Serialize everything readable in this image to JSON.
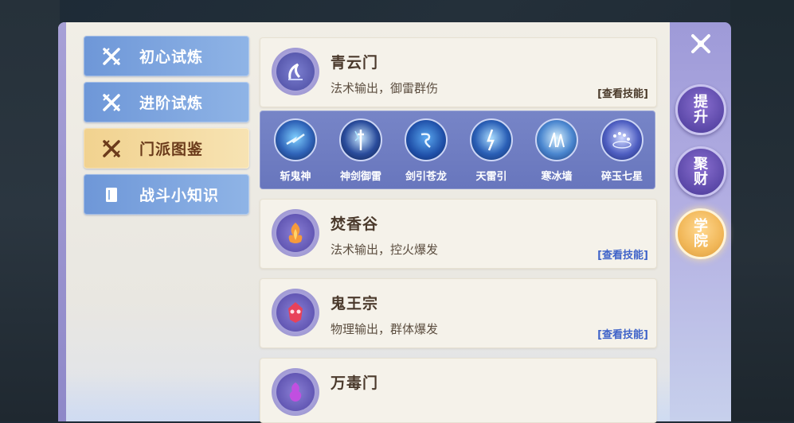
{
  "sidebar": {
    "items": [
      {
        "label": "初心试炼",
        "icon": "crossed-swords-icon",
        "active": false
      },
      {
        "label": "进阶试炼",
        "icon": "crossed-swords-icon",
        "active": false
      },
      {
        "label": "门派图鉴",
        "icon": "crossed-swords-icon",
        "active": true
      },
      {
        "label": "战斗小知识",
        "icon": "book-icon",
        "active": false
      }
    ]
  },
  "sects": [
    {
      "name": "青云门",
      "desc": "法术输出，御雷群伤",
      "link": "[查看技能]",
      "link_color": "#4a3a2a",
      "emblem": "qingyun-emblem-icon"
    },
    {
      "name": "焚香谷",
      "desc": "法术输出，控火爆发",
      "link": "[查看技能]",
      "link_color": "#3f63c9",
      "emblem": "fenxiang-emblem-icon"
    },
    {
      "name": "鬼王宗",
      "desc": "物理输出，群体爆发",
      "link": "[查看技能]",
      "link_color": "#3f63c9",
      "emblem": "guiwang-emblem-icon"
    },
    {
      "name": "万毒门",
      "desc": "",
      "link": "",
      "emblem": "wandu-emblem-icon"
    }
  ],
  "skills": [
    {
      "name": "斩鬼神",
      "icon": "lightning-slash-icon"
    },
    {
      "name": "神剑御雷",
      "icon": "lightning-sword-icon"
    },
    {
      "name": "剑引苍龙",
      "icon": "blue-dragon-icon"
    },
    {
      "name": "天雷引",
      "icon": "thunder-bolt-icon"
    },
    {
      "name": "寒冰墙",
      "icon": "ice-wall-icon"
    },
    {
      "name": "碎玉七星",
      "icon": "seven-stars-icon"
    }
  ],
  "rail": {
    "buttons": [
      {
        "label": "提升",
        "active": false
      },
      {
        "label": "聚财",
        "active": false
      },
      {
        "label": "学院",
        "active": true
      }
    ]
  },
  "colors": {
    "accent_blue": "#7fa6e0",
    "accent_gold": "#f3d79d",
    "rail_purple": "#5b48a8",
    "link_blue": "#3f63c9"
  }
}
